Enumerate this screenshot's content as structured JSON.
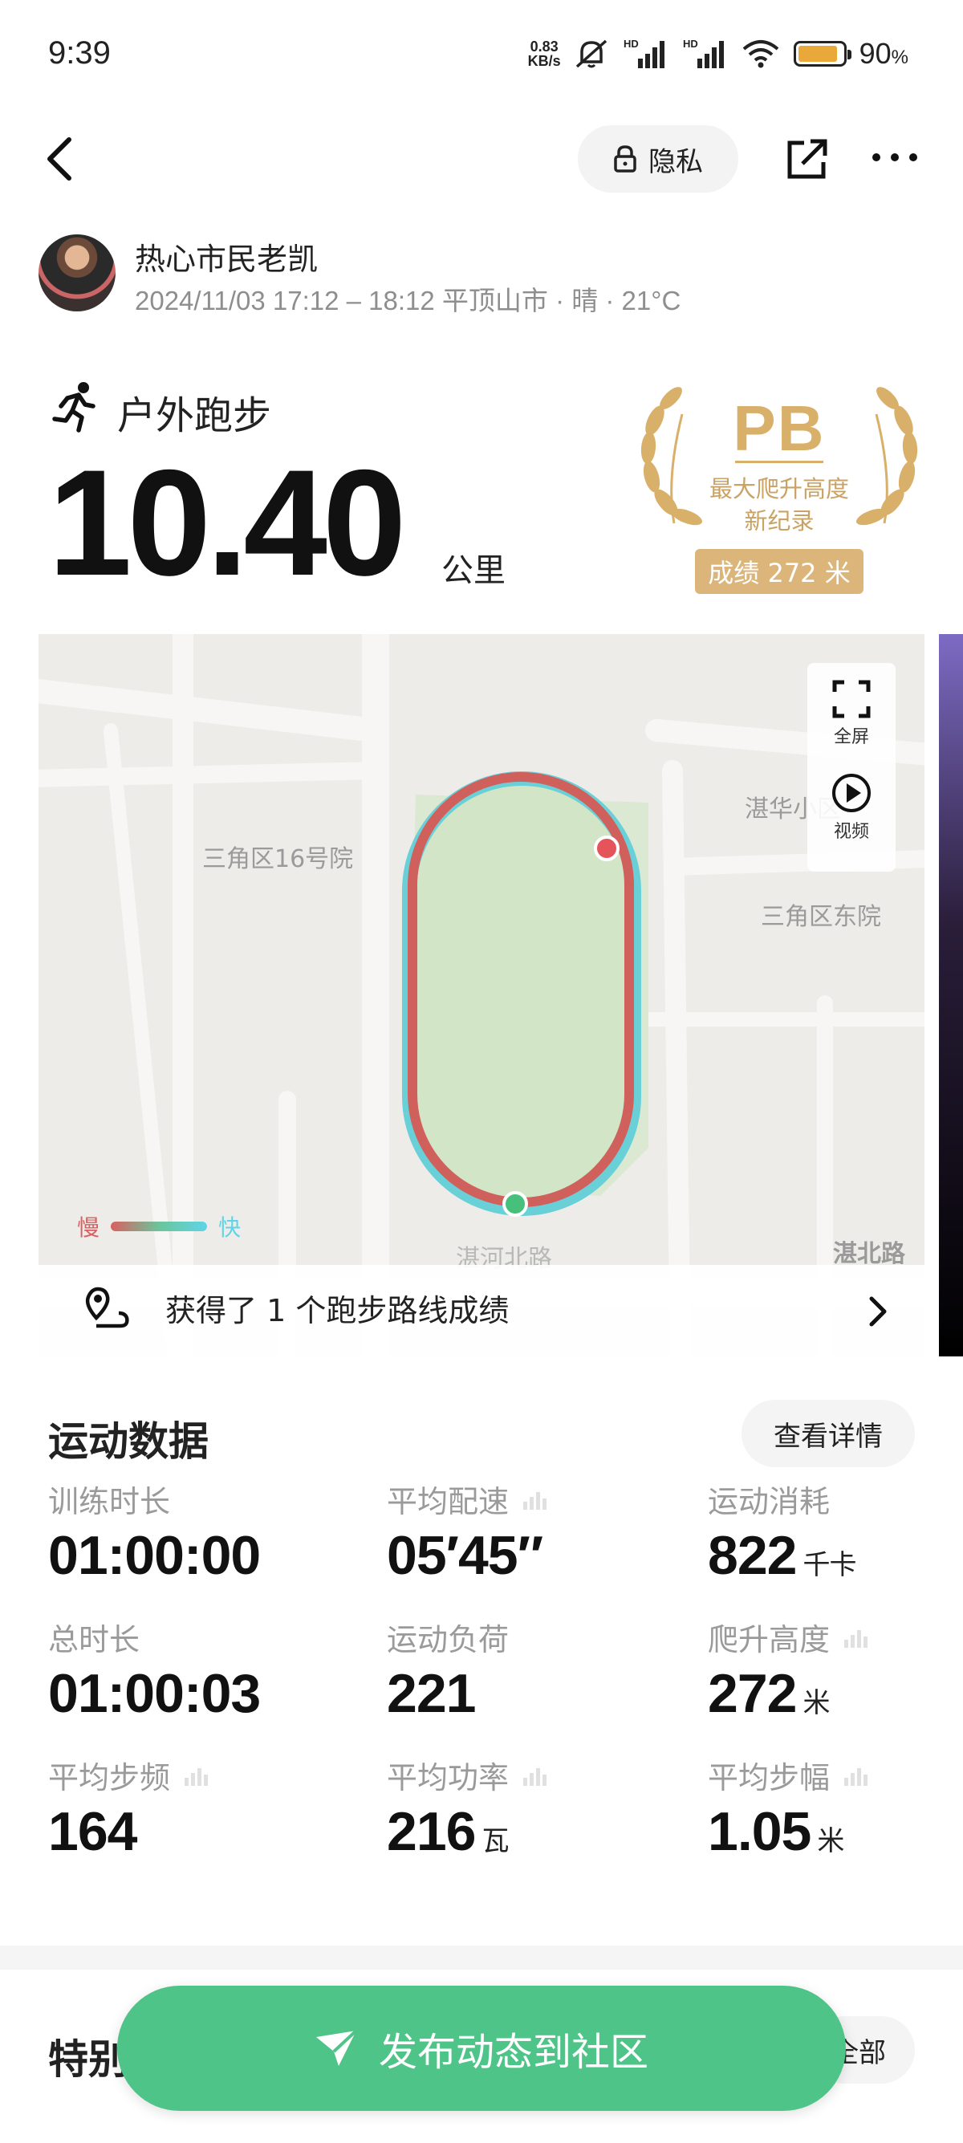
{
  "status_bar": {
    "time": "9:39",
    "net_speed_value": "0.83",
    "net_speed_unit": "KB/s",
    "signal1_label": "HD",
    "signal2_label": "HD",
    "battery_percent": "90",
    "battery_percent_sign": "%",
    "battery_level": 0.9,
    "battery_color": "#e9a93a"
  },
  "header": {
    "privacy_label": "隐私"
  },
  "user": {
    "name": "热心市民老凯",
    "meta": "2024/11/03 17:12 – 18:12 平顶山市 · 晴 · 21°C"
  },
  "workout": {
    "type": "户外跑步",
    "distance": "10.40",
    "distance_unit": "公里"
  },
  "pb": {
    "title": "PB",
    "line1": "最大爬升高度",
    "line2": "新纪录",
    "badge": "成绩 272 米",
    "color": "#d9b06a"
  },
  "map": {
    "fullscreen_label": "全屏",
    "video_label": "视频",
    "places": [
      "湛华小区",
      "三角区16号院",
      "三角区东院",
      "湛河北路",
      "湛北路"
    ],
    "legend_slow": "慢",
    "legend_fast": "快",
    "route_banner": "获得了 1 个跑步路线成绩",
    "slow_color": "#d96060",
    "fast_color": "#5fd4e8"
  },
  "stats": {
    "section_title": "运动数据",
    "detail_button": "查看详情",
    "items": [
      {
        "label": "训练时长",
        "value": "01:00:00",
        "unit": ""
      },
      {
        "label": "平均配速",
        "value": "05′45″",
        "unit": ""
      },
      {
        "label": "运动消耗",
        "value": "822",
        "unit": "千卡"
      },
      {
        "label": "总时长",
        "value": "01:00:03",
        "unit": ""
      },
      {
        "label": "运动负荷",
        "value": "221",
        "unit": ""
      },
      {
        "label": "爬升高度",
        "value": "272",
        "unit": "米"
      },
      {
        "label": "平均步频",
        "value": "164",
        "unit": ""
      },
      {
        "label": "平均功率",
        "value": "216",
        "unit": "瓦"
      },
      {
        "label": "平均步幅",
        "value": "1.05",
        "unit": "米"
      }
    ]
  },
  "special": {
    "title_partial": "特别",
    "all_button_partial": "全部"
  },
  "publish_button": "发布动态到社区",
  "accent_green": "#4fc488"
}
